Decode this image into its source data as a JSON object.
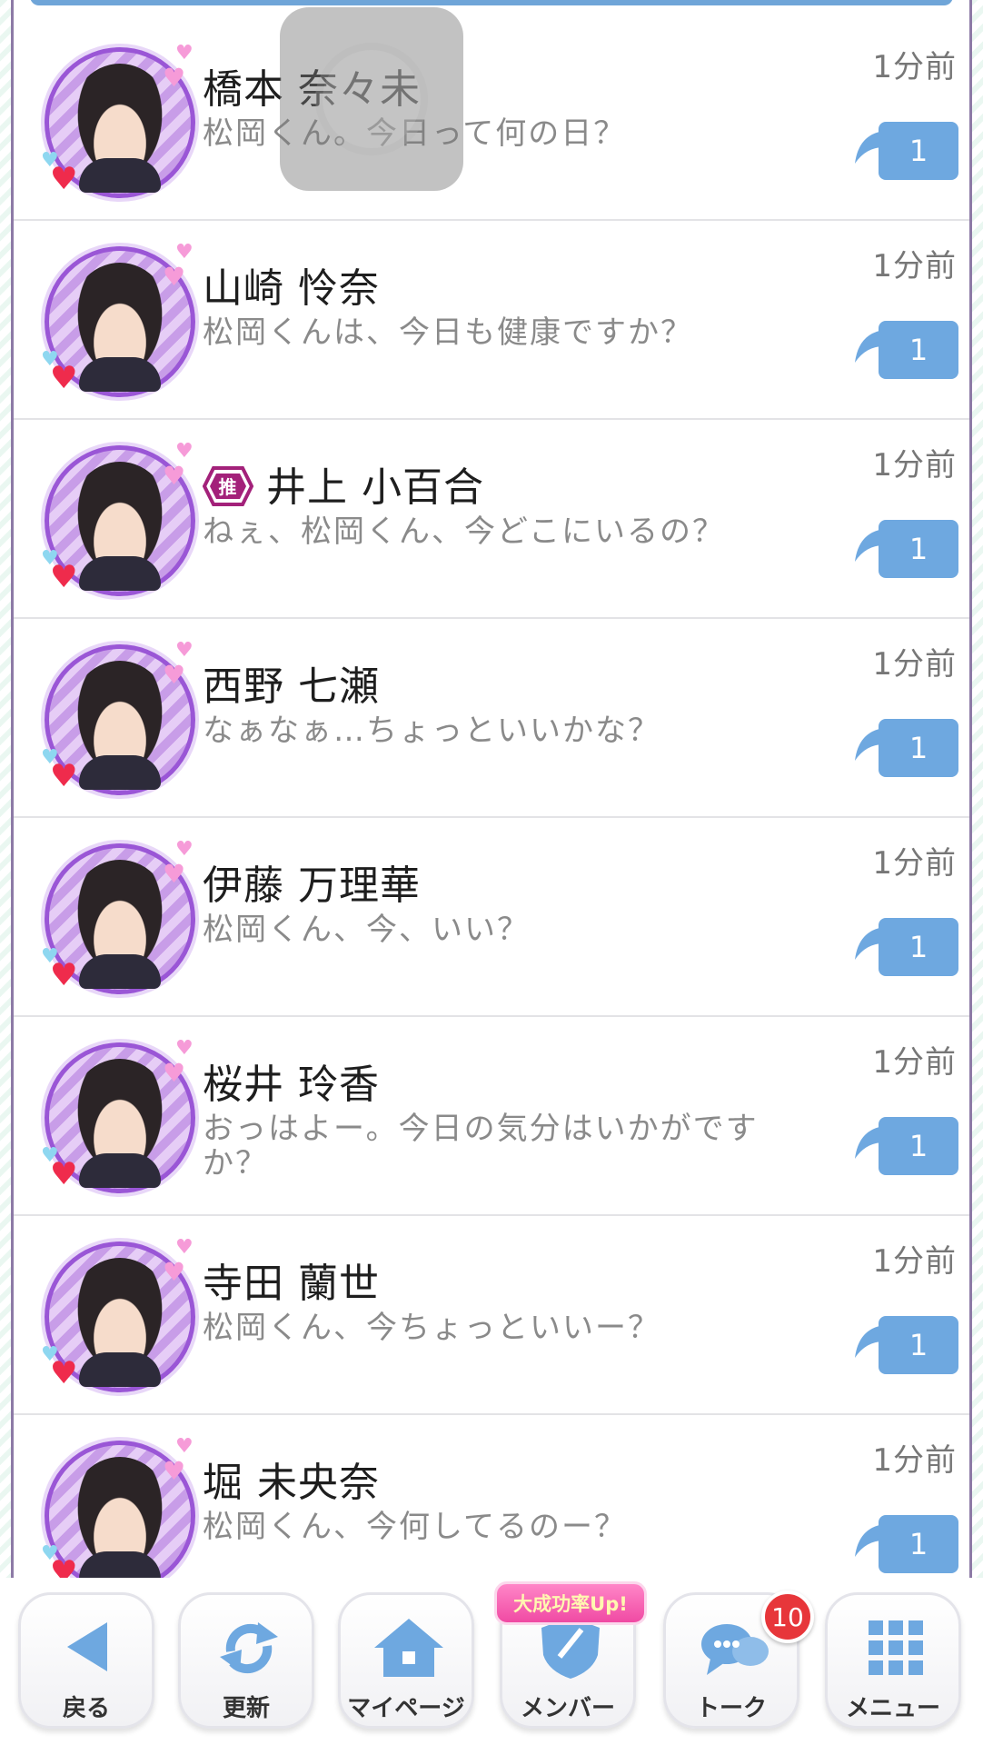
{
  "chats": [
    {
      "name": "橋本 奈々未",
      "message": "松岡くん。今日って何の日？",
      "time": "1分前",
      "unread": "1",
      "oshi": false
    },
    {
      "name": "山崎 怜奈",
      "message": "松岡くんは、今日も健康ですか？",
      "time": "1分前",
      "unread": "1",
      "oshi": false
    },
    {
      "name": "井上 小百合",
      "message": "ねぇ、松岡くん、今どこにいるの？",
      "time": "1分前",
      "unread": "1",
      "oshi": true,
      "oshi_label": "推"
    },
    {
      "name": "西野 七瀬",
      "message": "なぁなぁ…ちょっといいかな？",
      "time": "1分前",
      "unread": "1",
      "oshi": false
    },
    {
      "name": "伊藤 万理華",
      "message": "松岡くん、今、いい？",
      "time": "1分前",
      "unread": "1",
      "oshi": false
    },
    {
      "name": "桜井 玲香",
      "message": "おっはよー。今日の気分はいかがですか？",
      "time": "1分前",
      "unread": "1",
      "oshi": false
    },
    {
      "name": "寺田 蘭世",
      "message": "松岡くん、今ちょっといいー？",
      "time": "1分前",
      "unread": "1",
      "oshi": false
    },
    {
      "name": "堀 未央奈",
      "message": "松岡くん、今何してるのー？",
      "time": "1分前",
      "unread": "1",
      "oshi": false
    }
  ],
  "navbar": {
    "back": "戻る",
    "refresh": "更新",
    "mypage": "マイページ",
    "member": "メンバー",
    "talk": "トーク",
    "menu": "メニュー",
    "promo_ribbon": "大成功率Up!",
    "talk_badge": "10"
  },
  "colors": {
    "accent_blue": "#6ea8e0",
    "avatar_purple": "#9a56d6",
    "oshi_magenta": "#a3217a",
    "badge_red": "#e7363a"
  }
}
